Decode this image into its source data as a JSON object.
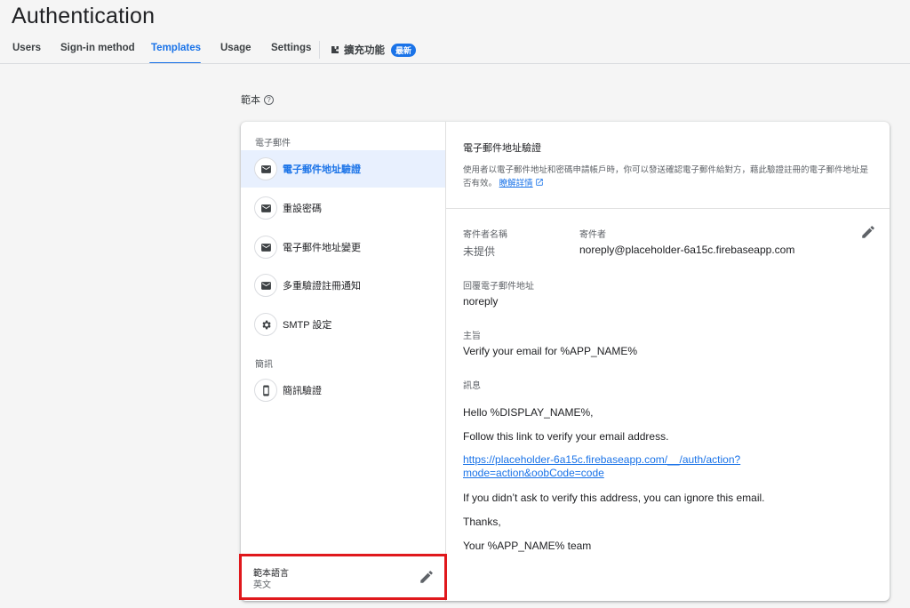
{
  "page": {
    "title": "Authentication"
  },
  "tabs": [
    {
      "label": "Users"
    },
    {
      "label": "Sign-in method"
    },
    {
      "label": "Templates"
    },
    {
      "label": "Usage"
    },
    {
      "label": "Settings"
    }
  ],
  "extension": {
    "label": "擴充功能",
    "badge": "最新",
    "icon": "extension-icon"
  },
  "section": {
    "label": "範本",
    "icon": "help-icon"
  },
  "sidebar": {
    "email_group": "電子郵件",
    "sms_group": "簡訊",
    "items": [
      {
        "label": "電子郵件地址驗證",
        "icon": "mail-icon",
        "active": true
      },
      {
        "label": "重設密碼",
        "icon": "mail-icon"
      },
      {
        "label": "電子郵件地址變更",
        "icon": "mail-icon"
      },
      {
        "label": "多重驗證註冊通知",
        "icon": "mail-icon"
      },
      {
        "label": "SMTP 設定",
        "icon": "gear-icon"
      },
      {
        "label": "簡訊驗證",
        "icon": "phone-icon"
      }
    ],
    "language": {
      "title": "範本語言",
      "value": "英文",
      "icon": "pencil-icon"
    }
  },
  "detail": {
    "title": "電子郵件地址驗證",
    "description": "使用者以電子郵件地址和密碼申請帳戶時，你可以發送確認電子郵件給對方，藉此驗證註冊的電子郵件地址是否有效。",
    "learn_more": "瞭解詳情",
    "sender_name_label": "寄件者名稱",
    "sender_name_value": "未提供",
    "sender_label": "寄件者",
    "sender_value": "noreply@placeholder-6a15c.firebaseapp.com",
    "reply_to_label": "回覆電子郵件地址",
    "reply_to_value": "noreply",
    "subject_label": "主旨",
    "subject_value": "Verify your email for %APP_NAME%",
    "message_label": "訊息",
    "message": {
      "greeting": "Hello %DISPLAY_NAME%,",
      "line1": "Follow this link to verify your email address.",
      "link": "https://placeholder-6a15c.firebaseapp.com/__/auth/action?mode=action&oobCode=code",
      "line2": "If you didn’t ask to verify this address, you can ignore this email.",
      "thanks": "Thanks,",
      "signoff": "Your %APP_NAME% team"
    }
  },
  "colors": {
    "accent": "#1a73e8",
    "highlight": "#e0181c"
  }
}
